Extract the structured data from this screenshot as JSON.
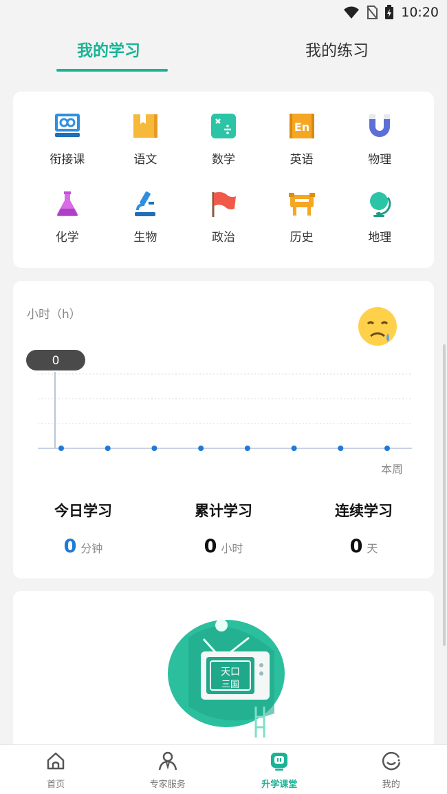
{
  "status": {
    "time": "10:20"
  },
  "tabs": [
    {
      "label": "我的学习",
      "active": true
    },
    {
      "label": "我的练习",
      "active": false
    }
  ],
  "subjects": [
    {
      "label": "衔接课",
      "icon": "bridge-course-icon"
    },
    {
      "label": "语文",
      "icon": "chinese-book-icon"
    },
    {
      "label": "数学",
      "icon": "math-icon"
    },
    {
      "label": "英语",
      "icon": "english-icon"
    },
    {
      "label": "物理",
      "icon": "magnet-icon"
    },
    {
      "label": "化学",
      "icon": "flask-icon"
    },
    {
      "label": "生物",
      "icon": "microscope-icon"
    },
    {
      "label": "政治",
      "icon": "flag-icon"
    },
    {
      "label": "历史",
      "icon": "history-icon"
    },
    {
      "label": "地理",
      "icon": "globe-icon"
    }
  ],
  "chart": {
    "unit_label": "小时（h）",
    "tooltip_value": "0",
    "week_label": "本周"
  },
  "chart_data": {
    "type": "line",
    "ylabel": "小时（h）",
    "xlabel": "本周",
    "points": 8,
    "values": [
      0,
      0,
      0,
      0,
      0,
      0,
      0,
      0
    ],
    "ylim": [
      0,
      3
    ],
    "grid": true
  },
  "stats": [
    {
      "title": "今日学习",
      "value": "0",
      "unit": "分钟",
      "highlight": true
    },
    {
      "title": "累计学习",
      "value": "0",
      "unit": "小时",
      "highlight": false
    },
    {
      "title": "连续学习",
      "value": "0",
      "unit": "天",
      "highlight": false
    }
  ],
  "promo": {
    "tv_text_1": "天口",
    "tv_text_2": "三国"
  },
  "nav": [
    {
      "label": "首页",
      "icon": "home-icon",
      "active": false
    },
    {
      "label": "专家服务",
      "icon": "expert-icon",
      "active": false
    },
    {
      "label": "升学课堂",
      "icon": "classroom-icon",
      "active": true
    },
    {
      "label": "我的",
      "icon": "profile-icon",
      "active": false
    }
  ],
  "colors": {
    "accent": "#1ab394",
    "blue": "#1e7ad6"
  }
}
